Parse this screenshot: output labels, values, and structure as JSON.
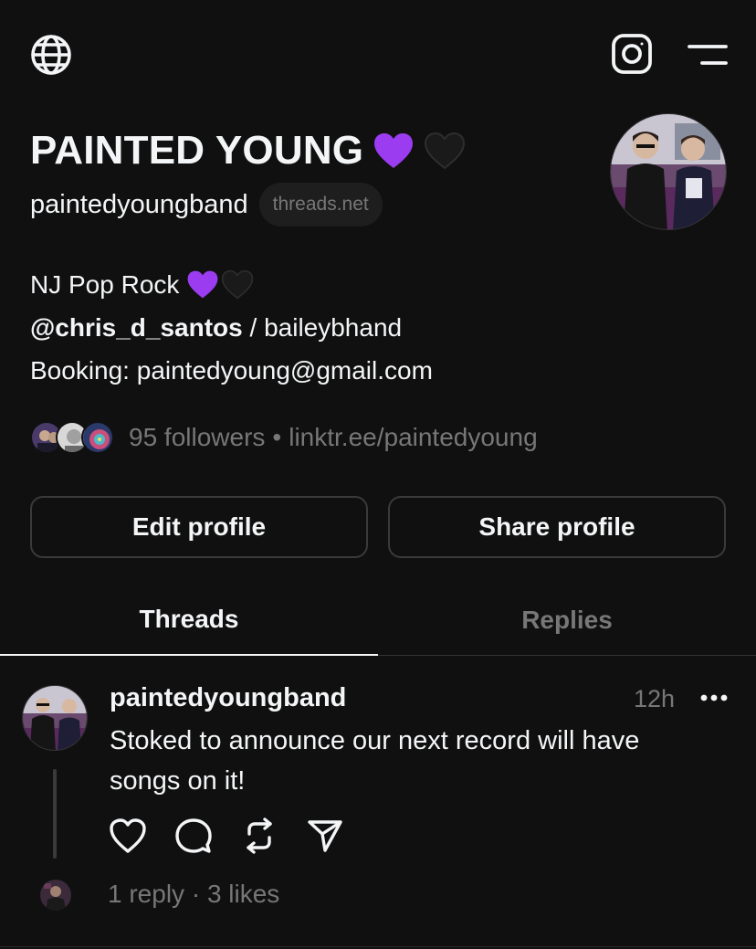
{
  "topbar": {
    "icons": [
      "globe-icon",
      "instagram-icon",
      "menu-icon"
    ]
  },
  "profile": {
    "name": "PAINTED YOUNG",
    "name_emojis": [
      "purple-heart",
      "black-heart"
    ],
    "username": "paintedyoungband",
    "domain_badge": "threads.net"
  },
  "bio": {
    "line1": "NJ Pop Rock",
    "mention": "@chris_d_santos",
    "line2_rest": " / baileybhand",
    "line3": "Booking: paintedyoung@gmail.com"
  },
  "followers": {
    "count_text": "95 followers",
    "separator": "•",
    "link": "linktr.ee/paintedyoung"
  },
  "buttons": {
    "edit": "Edit profile",
    "share": "Share profile"
  },
  "tabs": {
    "threads": "Threads",
    "replies": "Replies",
    "active": "Threads"
  },
  "post": {
    "author": "paintedyoungband",
    "time": "12h",
    "text": "Stoked to announce our next record will have songs on it!",
    "replies": "1 reply",
    "stats_separator": "·",
    "likes": "3 likes"
  },
  "colors": {
    "background": "#101010",
    "text": "#f3f5f7",
    "muted": "#777777",
    "border": "#3a3a3a",
    "purple_heart": "#9b3cf0"
  }
}
